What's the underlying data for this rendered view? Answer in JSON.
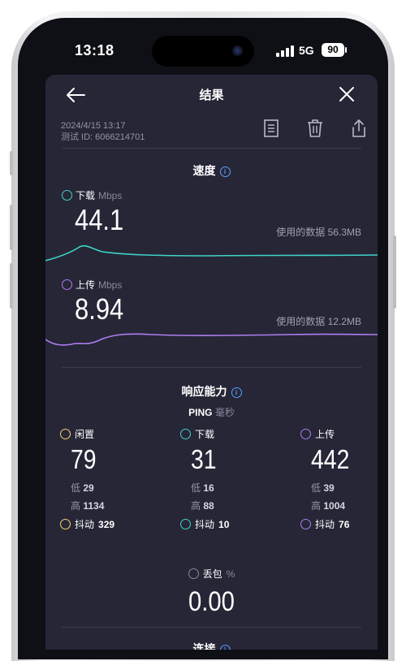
{
  "status_bar": {
    "time": "13:18",
    "network": "5G",
    "battery": "90"
  },
  "header": {
    "title": "结果"
  },
  "meta": {
    "datetime": "2024/4/15 13:17",
    "test_id": "测试 ID: 6066214701"
  },
  "speed": {
    "title": "速度",
    "download": {
      "label": "下载",
      "unit": "Mbps",
      "value": "44.1",
      "data_used": "使用的数据 56.3MB"
    },
    "upload": {
      "label": "上传",
      "unit": "Mbps",
      "value": "8.94",
      "data_used": "使用的数据 12.2MB"
    }
  },
  "responsiveness": {
    "title": "响应能力",
    "ping_label": "PING",
    "ping_unit": "毫秒",
    "idle": {
      "label": "闲置",
      "value": "79",
      "low_label": "低",
      "low": "29",
      "high_label": "高",
      "high": "1134",
      "jitter_label": "抖动",
      "jitter": "329"
    },
    "download": {
      "label": "下载",
      "value": "31",
      "low_label": "低",
      "low": "16",
      "high_label": "高",
      "high": "88",
      "jitter_label": "抖动",
      "jitter": "10"
    },
    "upload": {
      "label": "上传",
      "value": "442",
      "low_label": "低",
      "low": "39",
      "high_label": "高",
      "high": "1004",
      "jitter_label": "抖动",
      "jitter": "76"
    }
  },
  "packet_loss": {
    "label": "丢包",
    "unit": "%",
    "value": "0.00"
  },
  "connection": {
    "title": "连接"
  },
  "colors": {
    "download": "#3fd4c9",
    "upload": "#b07cf0",
    "idle": "#f3d46a",
    "info": "#5aa0ff",
    "background": "#262637"
  }
}
